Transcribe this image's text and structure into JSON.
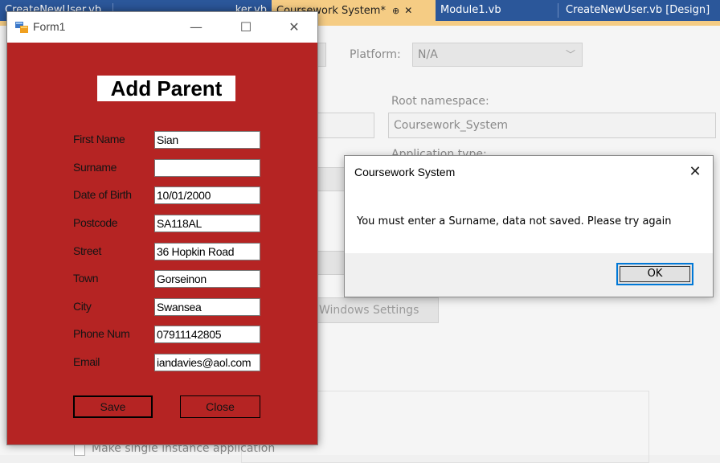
{
  "ide": {
    "tabs": [
      {
        "label": "CreateNewUser.vb"
      },
      {
        "label": "ker.vb"
      },
      {
        "label": "Coursework System*"
      },
      {
        "label": "Module1.vb"
      },
      {
        "label": "CreateNewUser.vb [Design]"
      }
    ],
    "tab_pin_icon": "⊕",
    "tab_close_icon": "✕",
    "platform_label": "Platform:",
    "platform_value": "N/A",
    "root_namespace_label": "Root namespace:",
    "root_namespace_value": "Coursework_System",
    "application_type_label": "Application type:",
    "windows_settings_label": "Windows Settings",
    "make_single_instance_label": "Make single instance application"
  },
  "form": {
    "title": "Form1",
    "heading": "Add Parent",
    "minimize_glyph": "—",
    "maximize_glyph": "☐",
    "close_glyph": "✕",
    "fields": [
      {
        "label": "First Name",
        "value": "Sian"
      },
      {
        "label": "Surname",
        "value": ""
      },
      {
        "label": "Date of Birth",
        "value": "10/01/2000"
      },
      {
        "label": "Postcode",
        "value": "SA118AL"
      },
      {
        "label": "Street",
        "value": "36 Hopkin Road"
      },
      {
        "label": "Town",
        "value": "Gorseinon"
      },
      {
        "label": "City",
        "value": "Swansea"
      },
      {
        "label": "Phone Num",
        "value": "07911142805"
      },
      {
        "label": "Email",
        "value": "iandavies@aol.com"
      }
    ],
    "save_label": "Save",
    "close_label": "Close",
    "background_color": "#b52423"
  },
  "message_box": {
    "title": "Coursework System",
    "close_glyph": "✕",
    "text": "You must enter a Surname, data not saved. Please try again",
    "ok_label": "OK"
  }
}
